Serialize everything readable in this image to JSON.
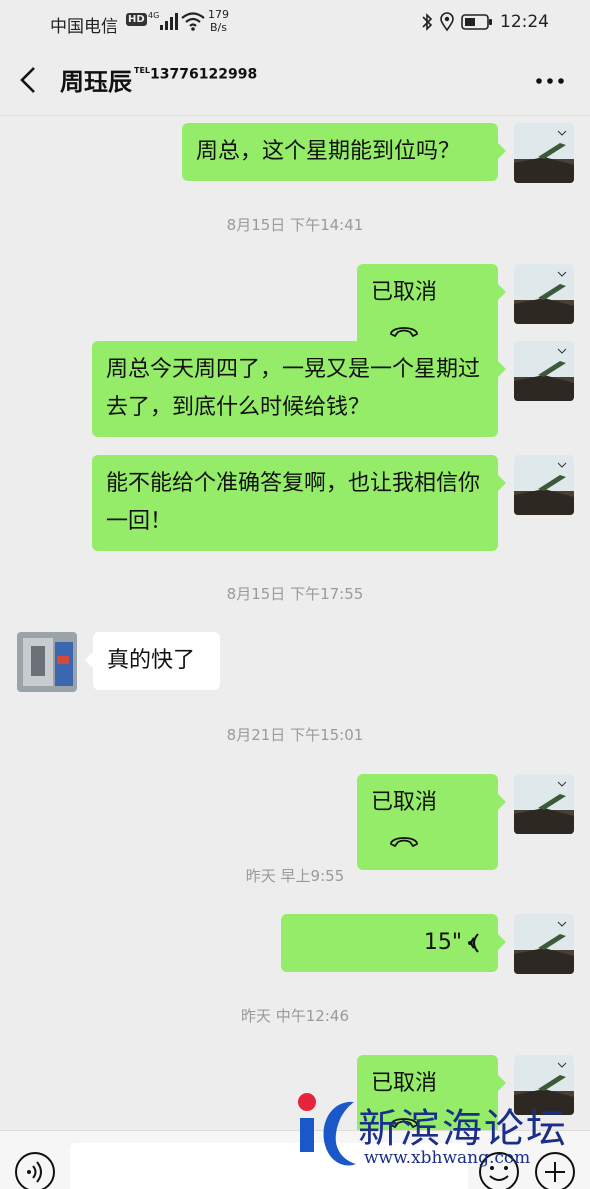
{
  "status_bar": {
    "carrier": "中国电信",
    "hd": "HD",
    "network": "4G",
    "speed_value": "179",
    "speed_unit": "B/s",
    "time": "12:24"
  },
  "header": {
    "title": "周珏辰",
    "tel_prefix": "TEL",
    "tel_number": "13776122998"
  },
  "messages": [
    {
      "type": "text",
      "side": "right",
      "text": "周总，这个星期能到位吗？"
    },
    {
      "type": "time",
      "text": "8月15日 下午14:41"
    },
    {
      "type": "call",
      "side": "right",
      "text": "已取消",
      "icon": "phone-hangup-icon"
    },
    {
      "type": "text",
      "side": "right",
      "text": "周总今天周四了，一晃又是一个星期过去了，到底什么时候给钱？"
    },
    {
      "type": "text",
      "side": "right",
      "text": "能不能给个准确答复啊，也让我相信你一回！"
    },
    {
      "type": "time",
      "text": "8月15日 下午17:55"
    },
    {
      "type": "text",
      "side": "left",
      "text": "真的快了"
    },
    {
      "type": "time",
      "text": "8月21日 下午15:01"
    },
    {
      "type": "call",
      "side": "right",
      "text": "已取消",
      "icon": "phone-hangup-icon"
    },
    {
      "type": "time",
      "text": "昨天 早上9:55"
    },
    {
      "type": "voice",
      "side": "right",
      "duration": "15\"",
      "icon": "voice-wave-icon"
    },
    {
      "type": "time",
      "text": "昨天 中午12:46"
    },
    {
      "type": "call",
      "side": "right",
      "text": "已取消",
      "icon": "phone-hangup-icon"
    }
  ],
  "input_bar": {
    "voice_icon": "voice-input-icon",
    "emoji_icon": "emoji-icon",
    "plus_icon": "plus-icon"
  },
  "watermark": {
    "name": "新滨海论坛",
    "url": "www.xbhwang.com"
  },
  "colors": {
    "background": "#ededed",
    "my_bubble": "#95ec69",
    "their_bubble": "#ffffff",
    "timestamp": "#9a9a9a",
    "watermark": "#1a2e8a"
  }
}
